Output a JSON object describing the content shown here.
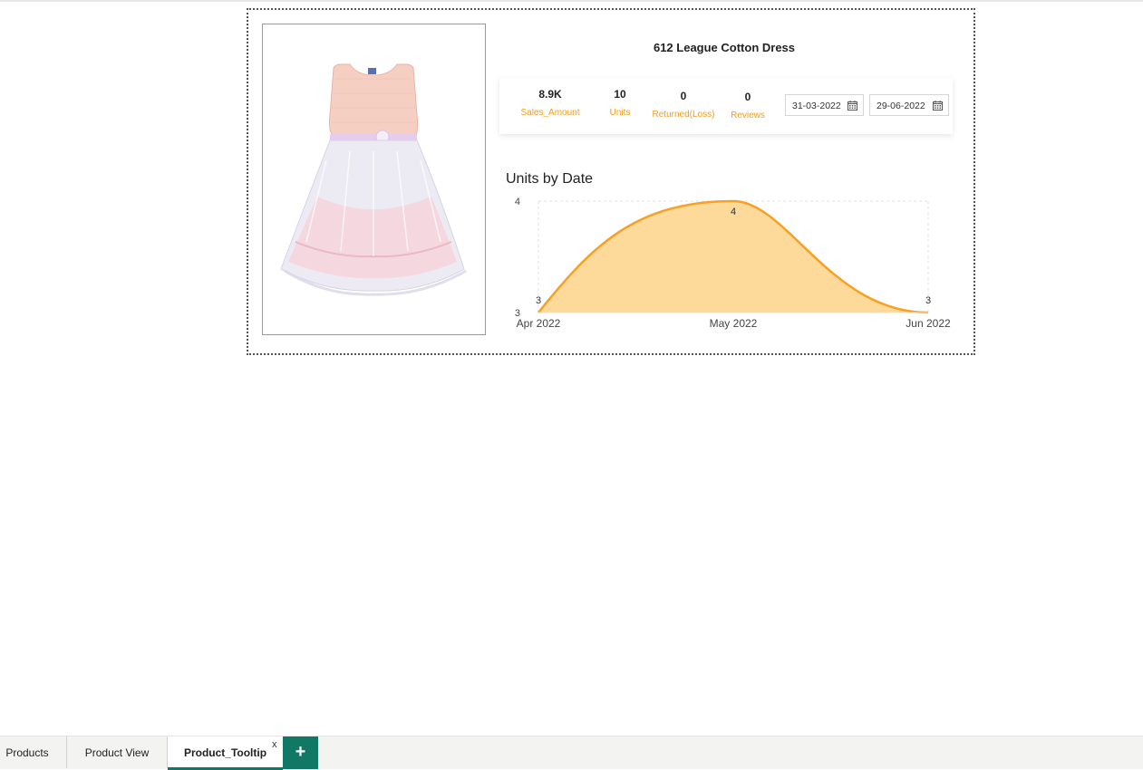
{
  "product": {
    "title": "612 League Cotton Dress"
  },
  "kpis": [
    {
      "value": "8.9K",
      "label": "Sales_Amount"
    },
    {
      "value": "10",
      "label": "Units"
    },
    {
      "value": "0",
      "label": "Returned(Loss)"
    },
    {
      "value": "0",
      "label": "Reviews"
    }
  ],
  "date_range": {
    "start": "31-03-2022",
    "end": "29-06-2022"
  },
  "chart_data": {
    "type": "area",
    "title": "Units by Date",
    "x": [
      "Apr 2022",
      "May 2022",
      "Jun 2022"
    ],
    "series": [
      {
        "values": [
          3,
          4,
          3
        ]
      }
    ],
    "ylim": [
      3,
      4
    ],
    "y_ticks": [
      "3",
      "4"
    ],
    "data_labels": [
      "3",
      "4",
      "3"
    ],
    "grid": true,
    "color": "#f7a023",
    "fill": "#fdd99a"
  },
  "tabs": [
    {
      "label": "Products"
    },
    {
      "label": "Product View"
    },
    {
      "label": "Product_Tooltip",
      "active": true,
      "close": "x"
    }
  ],
  "add_tab": {
    "label": "+"
  },
  "colors": {
    "accent": "#117865",
    "kpi_label": "#f29c1e"
  }
}
